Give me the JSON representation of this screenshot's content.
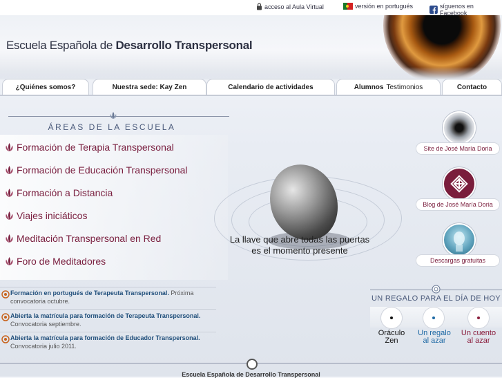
{
  "toplinks": {
    "aula": "acceso al Aula Virtual",
    "portugues": "versión en portugués",
    "facebook": "síguenos en Facebook"
  },
  "header": {
    "title_prefix": "Escuela Española de ",
    "title_bold": "Desarrollo Transpersonal"
  },
  "nav": {
    "items": [
      {
        "label": "¿Quiénes somos?"
      },
      {
        "label": "Nuestra sede: Kay Zen"
      },
      {
        "label": "Calendario de actividades"
      },
      {
        "label": "Alumnos",
        "secondary": "Testimonios"
      },
      {
        "label": "Contacto"
      }
    ]
  },
  "areas": {
    "title": "ÁREAS DE LA ESCUELA",
    "items": [
      "Formación de Terapia Transpersonal",
      "Formación de Educación Transpersonal",
      "Formación a Distancia",
      "Viajes iniciáticos",
      "Meditación Transpersonal en Red",
      "Foro de Meditadores"
    ]
  },
  "tagline": {
    "line1": "La llave que abre todas las puertas",
    "line2": "es el momento presente"
  },
  "sidebar": {
    "links": [
      {
        "label": "Site de José María Doria",
        "icon": "eye-icon"
      },
      {
        "label": "Blog de José María Doria",
        "icon": "knot-icon"
      },
      {
        "label": "Descargas gratuitas",
        "icon": "buddha-icon"
      }
    ]
  },
  "gift": {
    "title": "UN REGALO PARA EL DÍA DE HOY",
    "items": [
      {
        "line1": "Oráculo",
        "line2": "Zen",
        "color": "#111111"
      },
      {
        "line1": "Un regalo",
        "line2": "al azar",
        "color": "#1f6aa5"
      },
      {
        "line1": "Un cuento",
        "line2": "al azar",
        "color": "#8a1d3c"
      }
    ]
  },
  "news": [
    {
      "bold": "Formación en portugués de Terapeuta Transpersonal.",
      "rest": " Próxima convocatoria octubre."
    },
    {
      "bold": "Abierta la matrícula para formación de Terapeuta Transpersonal.",
      "rest": " Convocatoria septiembre."
    },
    {
      "bold": "Abierta la matrícula para formación de Educador Transpersonal.",
      "rest": " Convocatoria julio 2011."
    }
  ],
  "footer": {
    "text": "Escuela Española de Desarrollo Transpersonal"
  },
  "colors": {
    "accent_wine": "#7a2040",
    "accent_blue": "#1f4e7a"
  }
}
